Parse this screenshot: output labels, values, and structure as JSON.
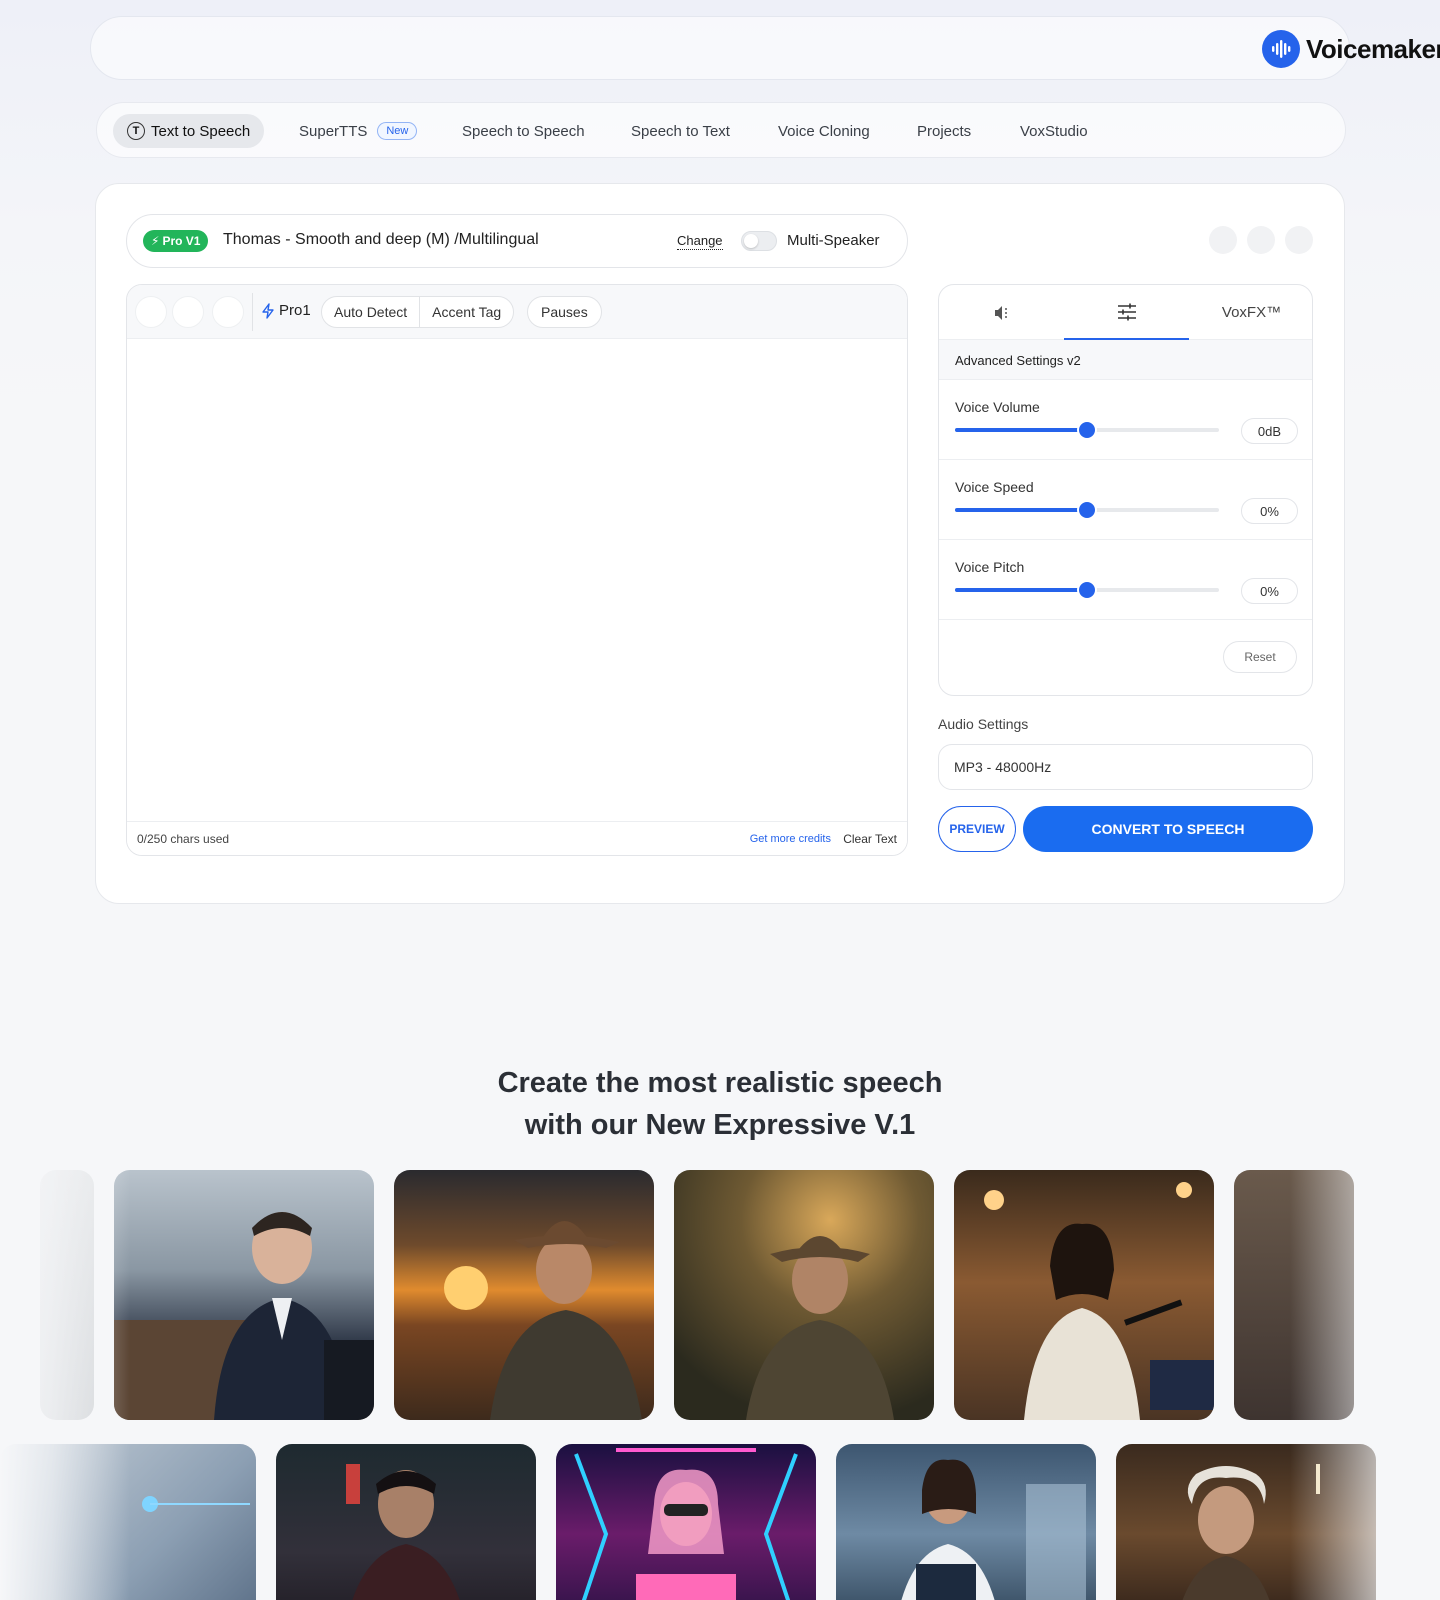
{
  "brand": {
    "name": "Voicemaker",
    "accent": "#2563eb"
  },
  "nav": {
    "items": [
      {
        "label": "Text to Speech",
        "active": true,
        "icon": "t-circle-icon"
      },
      {
        "label": "SuperTTS",
        "badge": "New"
      },
      {
        "label": "Speech to Speech"
      },
      {
        "label": "Speech to Text"
      },
      {
        "label": "Voice Cloning"
      },
      {
        "label": "Projects"
      },
      {
        "label": "VoxStudio"
      }
    ]
  },
  "voice": {
    "badge": "Pro V1",
    "name": "Thomas - Smooth and deep (M) /Multilingual",
    "change_label": "Change",
    "multi_speaker_label": "Multi-Speaker",
    "multi_speaker_on": false
  },
  "editor": {
    "engine_label": "Pro1",
    "tools": [
      "Auto Detect",
      "Accent Tag"
    ],
    "pauses_label": "Pauses",
    "text": "",
    "chars_used": "0/250 chars used",
    "credits_link": "Get more credits",
    "clear_label": "Clear Text"
  },
  "settings": {
    "tabs": [
      {
        "icon": "speaker-icon",
        "label": ""
      },
      {
        "icon": "sliders-icon",
        "label": "",
        "active": true
      },
      {
        "label": "VoxFX™"
      }
    ],
    "title": "Advanced Settings v2",
    "sliders": [
      {
        "label": "Voice Volume",
        "value": "0dB",
        "position": 0.5
      },
      {
        "label": "Voice Speed",
        "value": "0%",
        "position": 0.5
      },
      {
        "label": "Voice Pitch",
        "value": "0%",
        "position": 0.5
      }
    ],
    "reset_label": "Reset"
  },
  "audio": {
    "label": "Audio Settings",
    "format": "MP3 - 48000Hz"
  },
  "actions": {
    "preview_label": "PREVIEW",
    "convert_label": "CONVERT TO SPEECH"
  },
  "showcase": {
    "headline_line1": "Create the most realistic speech",
    "headline_line2": "with our New Expressive V.1"
  }
}
